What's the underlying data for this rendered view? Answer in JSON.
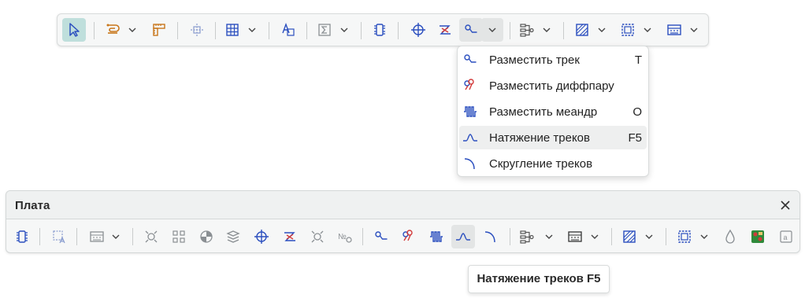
{
  "top_toolbar": {
    "buttons": [
      {
        "icon": "select-pointer-icon",
        "state": "active"
      },
      {
        "icon": "route-hand-icon"
      },
      {
        "icon": "measure-ruler-icon"
      },
      {
        "icon": "align-distribute-icon"
      },
      {
        "icon": "grid-table-icon"
      },
      {
        "icon": "text-label-icon"
      },
      {
        "icon": "sum-icon"
      },
      {
        "icon": "component-footprint-icon"
      },
      {
        "icon": "crosshair-origin-icon"
      },
      {
        "icon": "diffpair-route-icon"
      },
      {
        "icon": "route-track-icon",
        "state": "pressed"
      },
      {
        "icon": "net-tree-icon"
      },
      {
        "icon": "hatch-fill-icon"
      },
      {
        "icon": "dashed-selection-icon"
      },
      {
        "icon": "layer-view-icon"
      }
    ]
  },
  "route_menu": {
    "items": [
      {
        "label": "Разместить трек",
        "shortcut": "T",
        "icon": "route-track-icon"
      },
      {
        "label": "Разместить диффпару",
        "shortcut": "",
        "icon": "diffpair-icon"
      },
      {
        "label": "Разместить меандр",
        "shortcut": "O",
        "icon": "meander-icon"
      },
      {
        "label": "Натяжение треков",
        "shortcut": "F5",
        "icon": "track-tension-icon",
        "hovered": true
      },
      {
        "label": "Скругление треков",
        "shortcut": "",
        "icon": "track-rounding-icon"
      }
    ]
  },
  "board_panel": {
    "title": "Плата",
    "close_icon": "close-icon",
    "tools": [
      "component-footprint-icon",
      "text-frame-icon",
      "layer-view-icon",
      "via-icon",
      "pad-grid-icon",
      "drill-icon",
      "layers-stack-icon",
      "crosshair-origin-icon",
      "diffpair-route-icon",
      "via-check-icon",
      "numbering-icon",
      "route-track-icon",
      "diffpair-icon",
      "meander-icon",
      "track-tension-icon",
      "track-rounding-icon",
      "net-tree-icon",
      "layer-view-icon",
      "hatch-fill-icon",
      "dashed-selection-icon",
      "drop-icon",
      "copper-pour-icon",
      "text-frame-icon"
    ]
  },
  "tooltip": {
    "text": "Натяжение треков F5"
  },
  "colors": {
    "accent": "#2b4fbf",
    "active_bg": "#bfdfdc",
    "orange": "#c8761a",
    "red": "#d23a3a",
    "green": "#2f8a3a"
  }
}
